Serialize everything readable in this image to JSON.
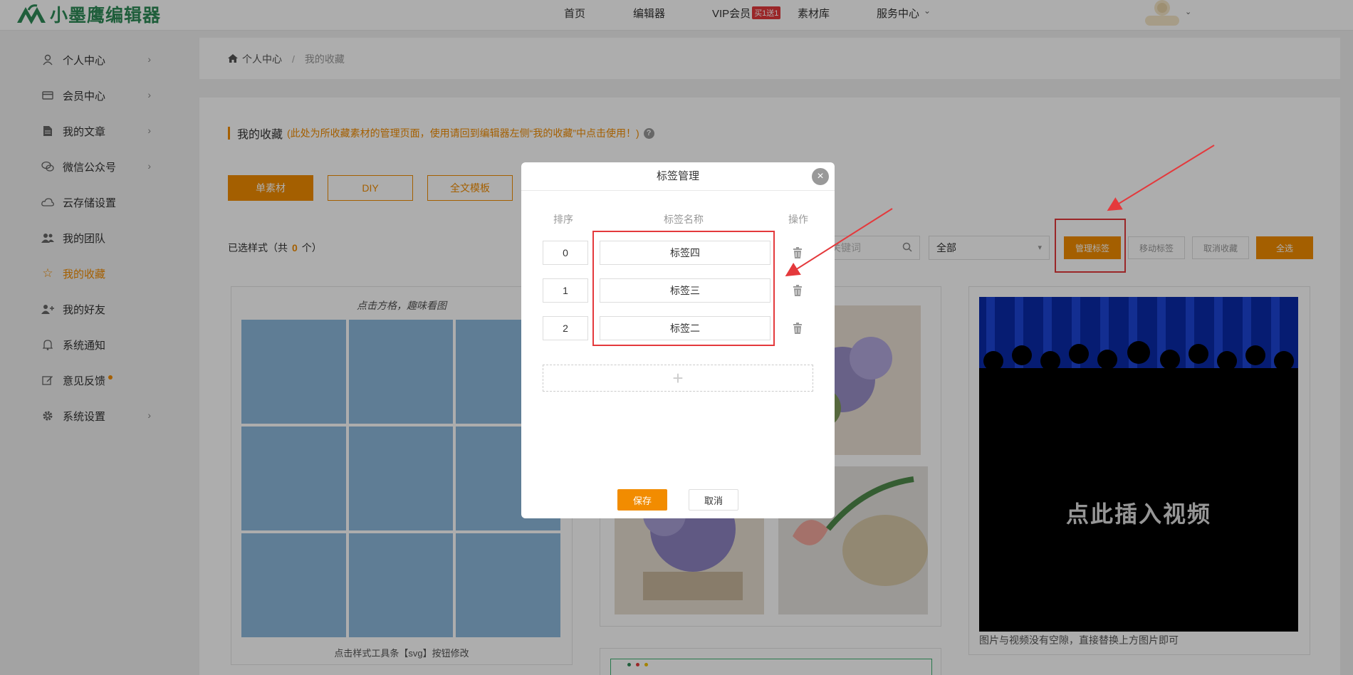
{
  "brand": {
    "name": "小墨鹰编辑器",
    "color": "#2e8b57"
  },
  "nav": {
    "home": "首页",
    "editor": "编辑器",
    "vip": "VIP会员",
    "vip_badge": "买1送1",
    "materials": "素材库",
    "service": "服务中心",
    "service_caret": "⌄"
  },
  "sidebar": {
    "items": [
      {
        "label": "个人中心",
        "icon": "user-icon",
        "chevron": "›"
      },
      {
        "label": "会员中心",
        "icon": "card-icon",
        "chevron": "›"
      },
      {
        "label": "我的文章",
        "icon": "document-icon",
        "chevron": "›"
      },
      {
        "label": "微信公众号",
        "icon": "wechat-icon",
        "chevron": "›"
      },
      {
        "label": "云存储设置",
        "icon": "cloud-icon"
      },
      {
        "label": "我的团队",
        "icon": "team-icon"
      },
      {
        "label": "我的收藏",
        "icon": "star-icon",
        "active": true
      },
      {
        "label": "我的好友",
        "icon": "add-friend-icon"
      },
      {
        "label": "系统通知",
        "icon": "bell-icon"
      },
      {
        "label": "意见反馈",
        "icon": "edit-icon",
        "dot": true
      },
      {
        "label": "系统设置",
        "icon": "gear-icon",
        "chevron": "›"
      }
    ]
  },
  "breadcrumb": {
    "home": "个人中心",
    "sep": "/",
    "current": "我的收藏"
  },
  "section": {
    "title": "我的收藏",
    "hint": "(此处为所收藏素材的管理页面，使用请回到编辑器左侧“我的收藏”中点击使用！)",
    "help": "?"
  },
  "tabs": [
    {
      "label": "单素材",
      "active": true
    },
    {
      "label": "DIY"
    },
    {
      "label": "全文模板"
    }
  ],
  "selected": {
    "prefix": "已选样式（共",
    "count": "0",
    "suffix": "个）"
  },
  "filters": {
    "keyword_placeholder": "关键词",
    "tag_select": "全部",
    "caret": "▾"
  },
  "actions": {
    "manage_tags": "管理标签",
    "move_tags": "移动标签",
    "cancel_fav": "取消收藏",
    "select_all": "全选"
  },
  "cards": {
    "grid_title": "点击方格，趣味看图",
    "grid_caption": "点击样式工具条【svg】按钮修改",
    "video_text": "点此插入视频",
    "video_caption": "图片与视频没有空隙，直接替换上方图片即可"
  },
  "modal": {
    "title": "标签管理",
    "close": "×",
    "col_order": "排序",
    "col_name": "标签名称",
    "col_action": "操作",
    "rows": [
      {
        "order": "0",
        "name": "标签四"
      },
      {
        "order": "1",
        "name": "标签三"
      },
      {
        "order": "2",
        "name": "标签二"
      }
    ],
    "add": "+",
    "save": "保存",
    "cancel": "取消"
  },
  "colors": {
    "accent": "#f28c00",
    "annotation": "#e4393c"
  }
}
